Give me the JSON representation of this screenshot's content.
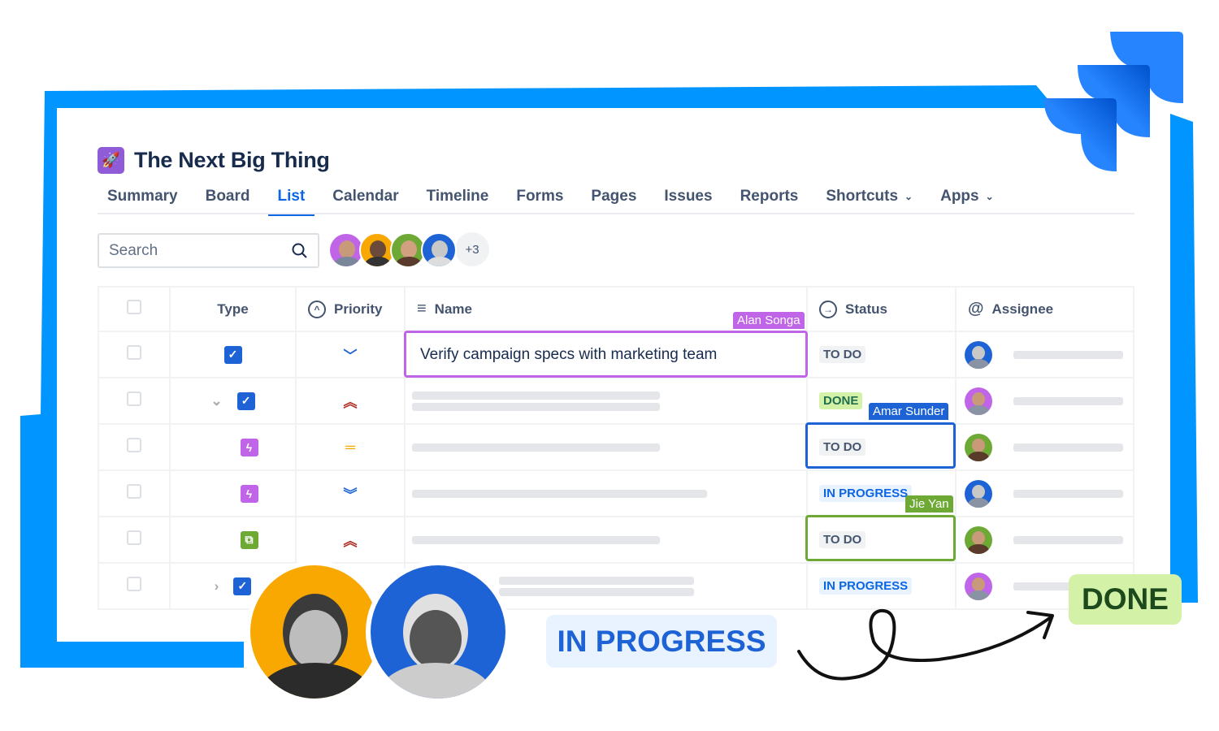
{
  "colors": {
    "frame": "#0095ff",
    "accent": "#0c66e4",
    "logo": "#2684ff",
    "name_collab": "#c064e8",
    "amar": "#1d63d6",
    "jie": "#6ea835"
  },
  "project": {
    "icon": "rocket-icon",
    "title": "The Next Big Thing"
  },
  "tabs": [
    {
      "label": "Summary"
    },
    {
      "label": "Board"
    },
    {
      "label": "List",
      "active": true
    },
    {
      "label": "Calendar"
    },
    {
      "label": "Timeline"
    },
    {
      "label": "Forms"
    },
    {
      "label": "Pages"
    },
    {
      "label": "Issues"
    },
    {
      "label": "Reports"
    },
    {
      "label": "Shortcuts",
      "dropdown": true
    },
    {
      "label": "Apps",
      "dropdown": true
    }
  ],
  "search": {
    "placeholder": "Search"
  },
  "avatars": {
    "colors": [
      "#c064e8",
      "#f8a800",
      "#6ea835",
      "#1d63d6"
    ],
    "more": "+3"
  },
  "table": {
    "headers": {
      "type": "Type",
      "priority": "Priority",
      "name": "Name",
      "status": "Status",
      "assignee": "Assignee"
    },
    "rows": [
      {
        "type": "task",
        "priority": "low",
        "name": "Verify campaign specs with marketing team",
        "status": "TO DO",
        "assignee_color": "#1d63d6"
      },
      {
        "type": "task",
        "expand": "down",
        "priority": "highest",
        "name": "",
        "status": "DONE",
        "assignee_color": "#c064e8"
      },
      {
        "type": "subtask-purple",
        "priority": "medium",
        "name": "",
        "status": "TO DO",
        "assignee_color": "#6ea835"
      },
      {
        "type": "subtask-purple",
        "priority": "lowest",
        "name": "",
        "status": "IN PROGRESS",
        "assignee_color": "#1d63d6"
      },
      {
        "type": "subtask-green",
        "priority": "highest",
        "name": "",
        "status": "TO DO",
        "assignee_color": "#6ea835"
      },
      {
        "type": "task",
        "expand": "right",
        "priority": "",
        "name": "",
        "status": "IN PROGRESS",
        "assignee_color": "#c064e8"
      }
    ]
  },
  "collaborators": {
    "name_cell": "Alan Songa",
    "status_row3": "Amar Sunder",
    "status_row5": "Jie Yan"
  },
  "overlay": {
    "in_progress": "IN PROGRESS",
    "done": "DONE"
  }
}
